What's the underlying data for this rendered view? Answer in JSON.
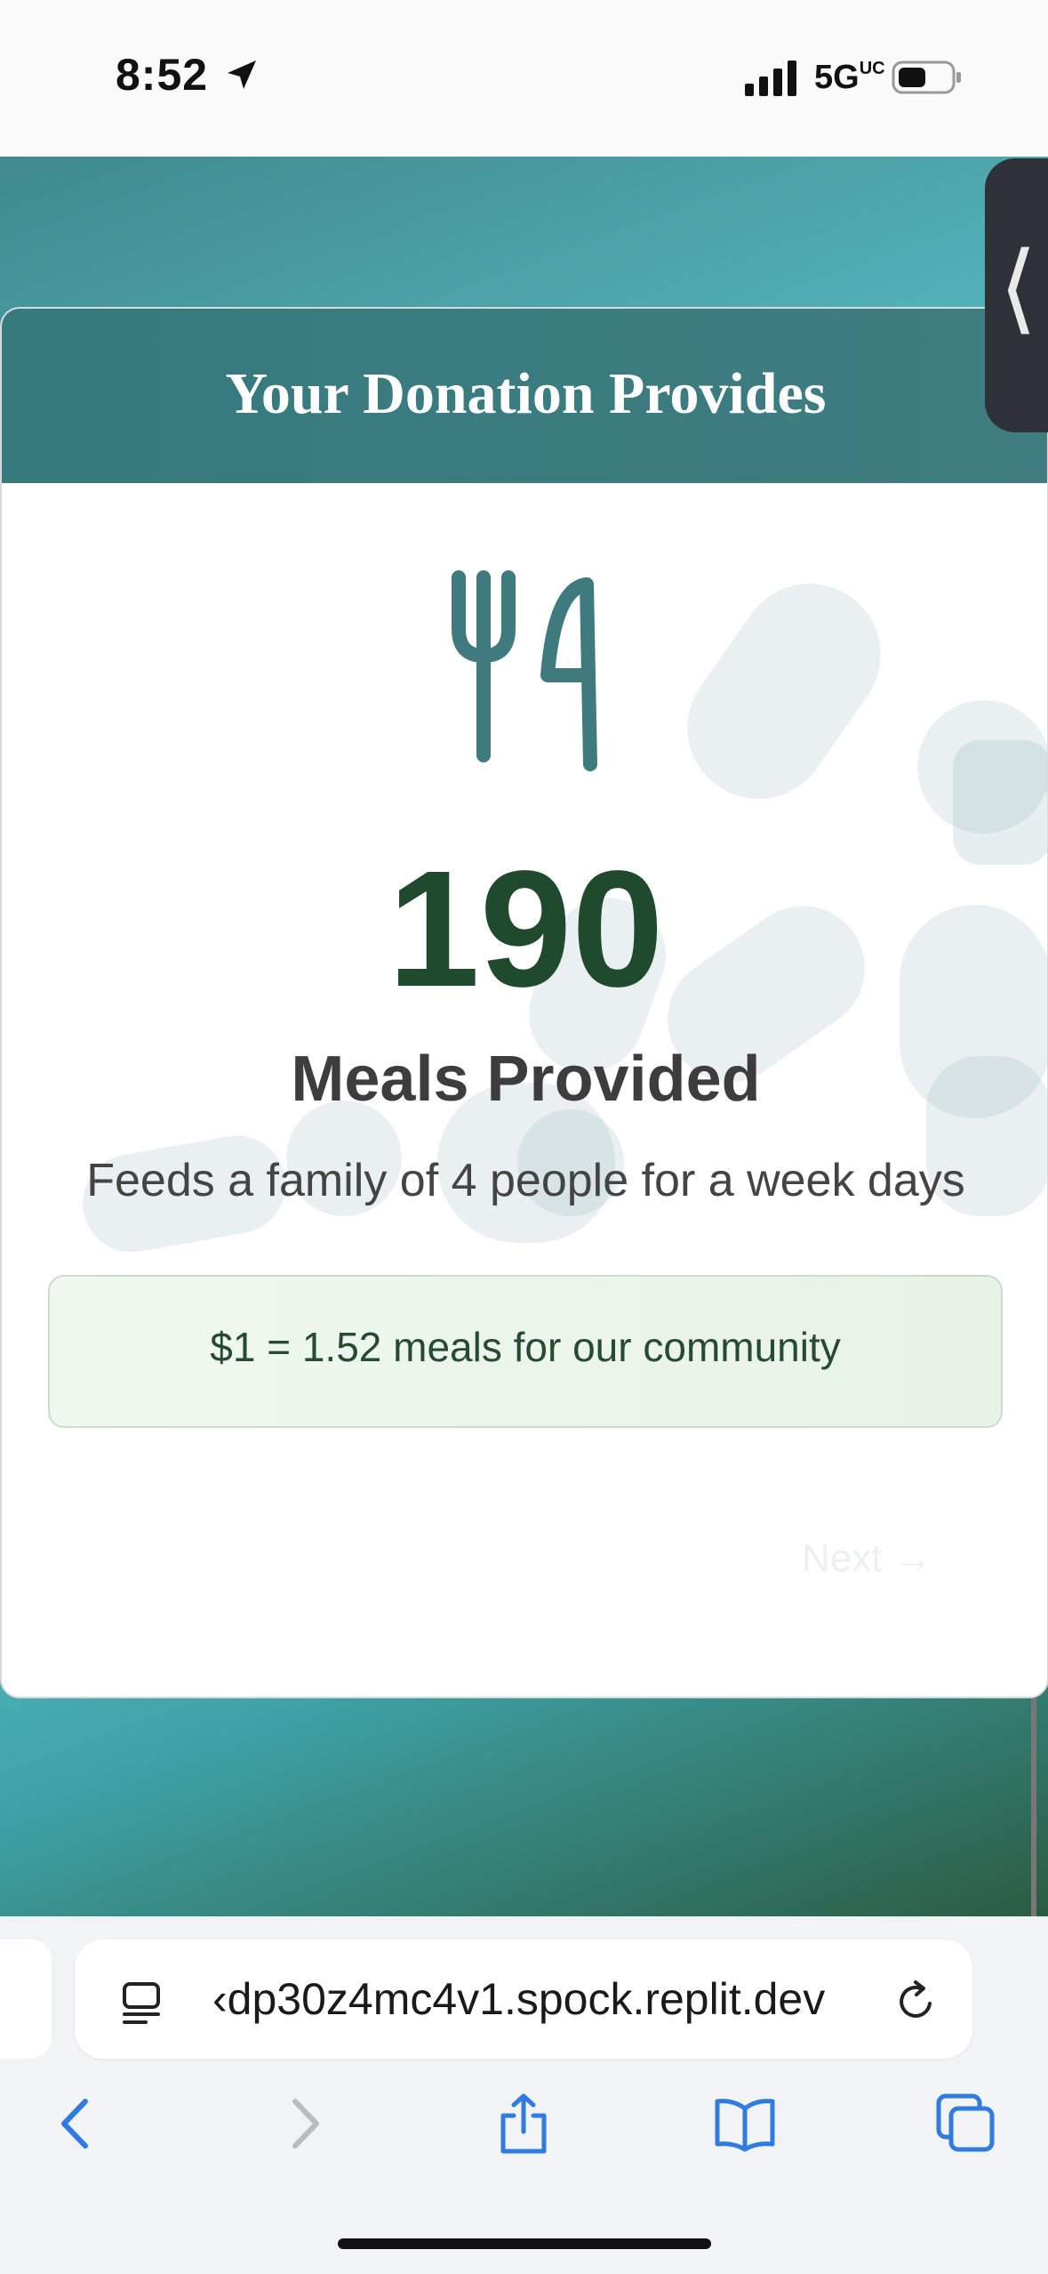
{
  "status_bar": {
    "time": "8:52",
    "network": "5G",
    "network_sub": "UC"
  },
  "card": {
    "title": "Your Donation Provides",
    "meals_count": "190",
    "meals_label": "Meals Provided",
    "description": "Feeds a family of 4 people for a week days",
    "rate_text": "$1 = 1.52 meals for our community",
    "next_label": "Next →"
  },
  "side_tab": {
    "label": "⟨"
  },
  "browser": {
    "url": "‹dp30z4mc4v1.spock.replit.dev"
  },
  "colors": {
    "teal_header": "#367a7e",
    "meals_number": "#1f4a2d",
    "rate_box_bg": "#eff7ef",
    "link_blue": "#2f7be0"
  }
}
